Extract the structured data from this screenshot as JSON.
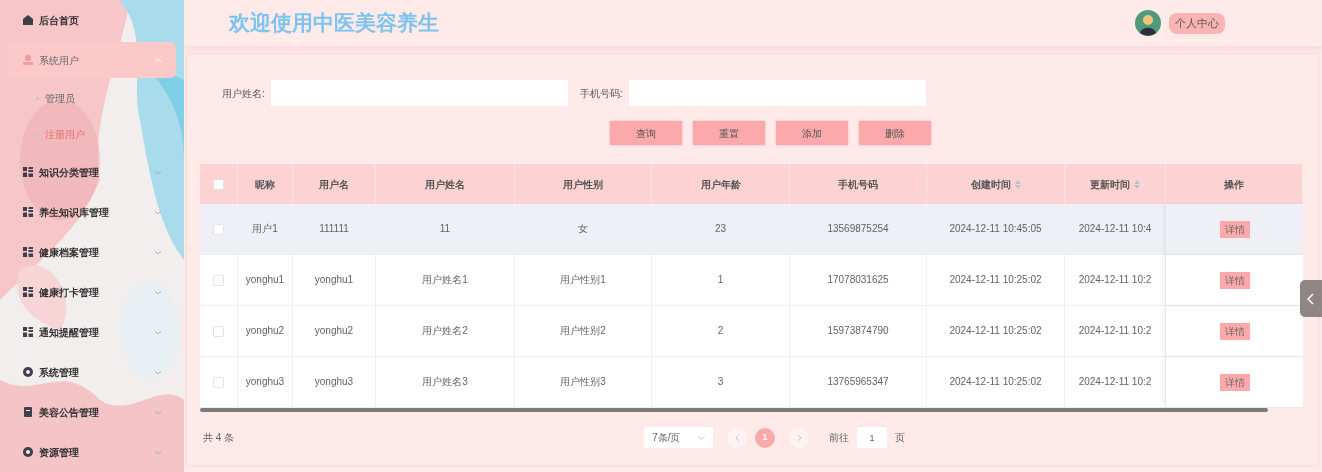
{
  "sidebar": {
    "items": [
      {
        "label": "后台首页",
        "kind": "home",
        "selected": false
      },
      {
        "label": "系统用户",
        "kind": "user",
        "selected": true,
        "expanded": true,
        "children": [
          {
            "label": "管理员",
            "selected": false
          },
          {
            "label": "注册用户",
            "selected": true
          }
        ]
      },
      {
        "label": "知识分类管理",
        "kind": "grid",
        "selected": false,
        "expanded": false
      },
      {
        "label": "养生知识库管理",
        "kind": "grid",
        "selected": false,
        "expanded": false
      },
      {
        "label": "健康档案管理",
        "kind": "grid",
        "selected": false,
        "expanded": false
      },
      {
        "label": "健康打卡管理",
        "kind": "grid",
        "selected": false,
        "expanded": false
      },
      {
        "label": "通知提醒管理",
        "kind": "grid",
        "selected": false,
        "expanded": false
      },
      {
        "label": "系统管理",
        "kind": "gear",
        "selected": false,
        "expanded": false
      },
      {
        "label": "美容公告管理",
        "kind": "doc",
        "selected": false,
        "expanded": false
      },
      {
        "label": "资源管理",
        "kind": "gear",
        "selected": false,
        "expanded": false
      }
    ]
  },
  "header": {
    "title": "欢迎使用中医美容养生",
    "profile_button": "个人中心"
  },
  "search": {
    "fields": [
      {
        "label": "用户姓名:"
      },
      {
        "label": "手机号码:"
      }
    ],
    "buttons": [
      "查询",
      "重置",
      "添加",
      "删除"
    ]
  },
  "table": {
    "columns": [
      {
        "label": "昵称"
      },
      {
        "label": "用户名"
      },
      {
        "label": "用户姓名"
      },
      {
        "label": "用户性别"
      },
      {
        "label": "用户年龄"
      },
      {
        "label": "手机号码"
      },
      {
        "label": "创建时间",
        "sortable": true
      },
      {
        "label": "更新时间",
        "sortable": true
      },
      {
        "label": "操作"
      }
    ],
    "header_checked": false,
    "rows": [
      {
        "checked": false,
        "highlighted": true,
        "cells": [
          "用户1",
          "111111",
          "11",
          "女",
          "23",
          "13569875254",
          "2024-12-11 10:45:05",
          "2024-12-11 10:4"
        ],
        "action": "详情"
      },
      {
        "checked": false,
        "highlighted": false,
        "cells": [
          "yonghu1",
          "yonghu1",
          "用户姓名1",
          "用户性别1",
          "1",
          "17078031625",
          "2024-12-11 10:25:02",
          "2024-12-11 10:2"
        ],
        "action": "详情"
      },
      {
        "checked": false,
        "highlighted": false,
        "cells": [
          "yonghu2",
          "yonghu2",
          "用户姓名2",
          "用户性别2",
          "2",
          "15973874790",
          "2024-12-11 10:25:02",
          "2024-12-11 10:2"
        ],
        "action": "详情"
      },
      {
        "checked": false,
        "highlighted": false,
        "cells": [
          "yonghu3",
          "yonghu3",
          "用户姓名3",
          "用户性别3",
          "3",
          "13765965347",
          "2024-12-11 10:25:02",
          "2024-12-11 10:2"
        ],
        "action": "详情"
      }
    ]
  },
  "pagination": {
    "total": "共 4 条",
    "page_size": "7条/页",
    "pages": [
      {
        "label": "1",
        "selected": true
      }
    ],
    "goto_label": "前往",
    "goto_value": "1",
    "goto_suffix": "页"
  }
}
